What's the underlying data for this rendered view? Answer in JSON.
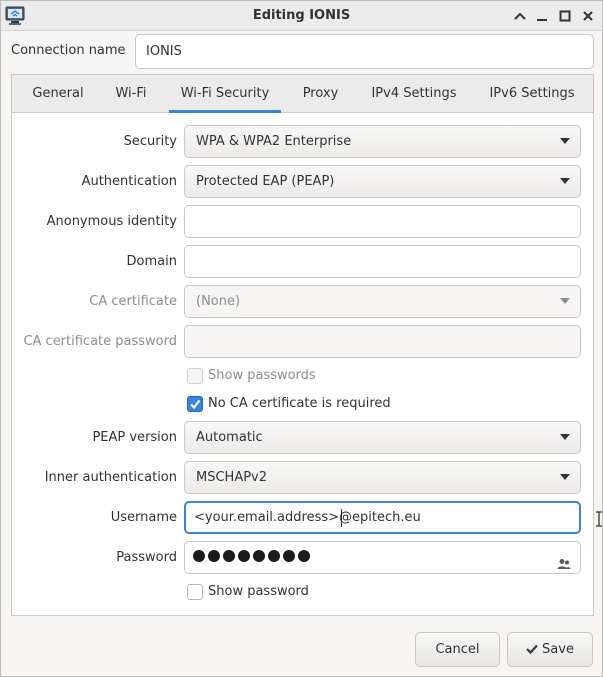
{
  "window": {
    "title": "Editing IONIS",
    "controls": {
      "shade": "chevron-up-icon",
      "minimize": "minimize-icon",
      "maximize": "maximize-icon",
      "close": "close-icon"
    }
  },
  "connection": {
    "label": "Connection name",
    "value": "IONIS"
  },
  "tabs": [
    {
      "label": "General"
    },
    {
      "label": "Wi-Fi"
    },
    {
      "label": "Wi-Fi Security",
      "active": true
    },
    {
      "label": "Proxy"
    },
    {
      "label": "IPv4 Settings"
    },
    {
      "label": "IPv6 Settings"
    }
  ],
  "form": {
    "security": {
      "label": "Security",
      "value": "WPA & WPA2 Enterprise"
    },
    "authentication": {
      "label": "Authentication",
      "value": "Protected EAP (PEAP)"
    },
    "anonymous_identity": {
      "label": "Anonymous identity",
      "value": ""
    },
    "domain": {
      "label": "Domain",
      "value": ""
    },
    "ca_certificate": {
      "label": "CA certificate",
      "value": "(None)",
      "enabled": false
    },
    "ca_certificate_password": {
      "label": "CA certificate password",
      "value": "",
      "enabled": false
    },
    "show_passwords": {
      "label": "Show passwords",
      "checked": false,
      "enabled": false
    },
    "no_ca_required": {
      "label": "No CA certificate is required",
      "checked": true
    },
    "peap_version": {
      "label": "PEAP version",
      "value": "Automatic"
    },
    "inner_authentication": {
      "label": "Inner authentication",
      "value": "MSCHAPv2"
    },
    "username": {
      "label": "Username",
      "value": "<your.email.address>@epitech.eu"
    },
    "password": {
      "label": "Password",
      "masked_length": 8,
      "icon": "user-group-icon"
    },
    "show_password": {
      "label": "Show password",
      "checked": false
    }
  },
  "buttons": {
    "cancel": "Cancel",
    "save": "Save",
    "save_icon": "checkmark-icon"
  },
  "colors": {
    "accent": "#3584e4",
    "titlebar": "#ebebeb",
    "background": "#f6f5f4"
  }
}
